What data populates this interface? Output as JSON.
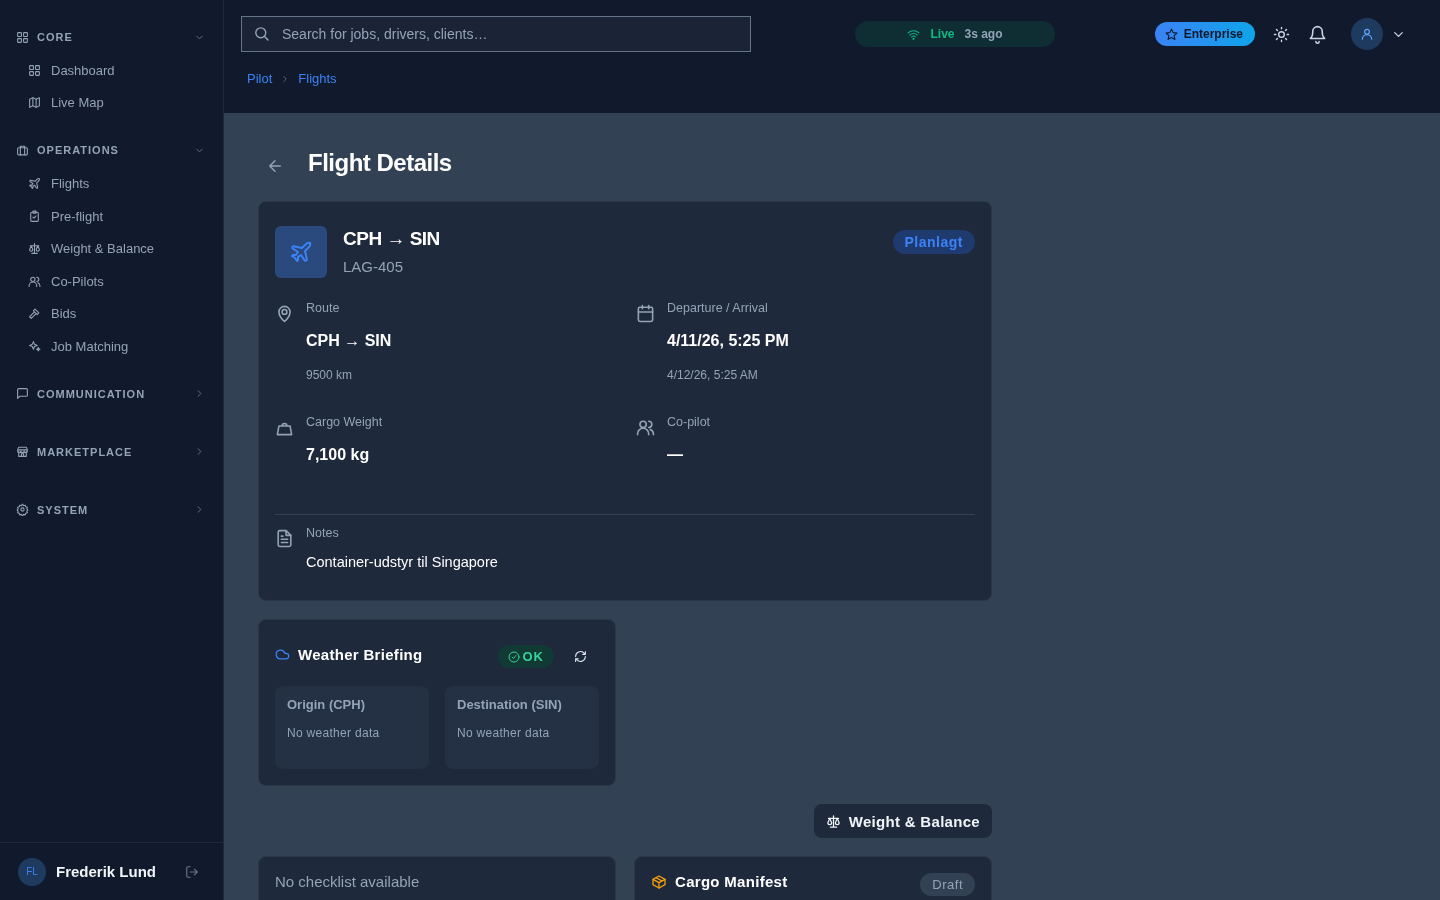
{
  "sidebar": {
    "groups": [
      {
        "label": "CORE",
        "expanded": true,
        "items": [
          "Dashboard",
          "Live Map"
        ]
      },
      {
        "label": "OPERATIONS",
        "expanded": true,
        "items": [
          "Flights",
          "Pre-flight",
          "Weight & Balance",
          "Co-Pilots",
          "Bids",
          "Job Matching"
        ]
      },
      {
        "label": "COMMUNICATION",
        "expanded": false
      },
      {
        "label": "MARKETPLACE",
        "expanded": false
      },
      {
        "label": "SYSTEM",
        "expanded": false
      }
    ],
    "user": {
      "initials": "FL",
      "name": "Frederik Lund"
    }
  },
  "topbar": {
    "search": {
      "placeholder": "Search for jobs, drivers, clients…"
    },
    "live": {
      "label": "Live",
      "age": "3s ago"
    },
    "plan_badge": "Enterprise"
  },
  "breadcrumb": [
    "Pilot",
    "Flights"
  ],
  "page": {
    "title": "Flight Details"
  },
  "flight": {
    "route": "CPH → SIN",
    "code": "LAG-405",
    "status": "Planlagt",
    "fields": [
      {
        "label": "Route",
        "value": "CPH → SIN",
        "sub": "9500 km"
      },
      {
        "label": "Departure / Arrival",
        "value": "4/11/26, 5:25 PM",
        "sub": "4/12/26, 5:25 AM"
      },
      {
        "label": "Cargo Weight",
        "value": "7,100 kg"
      },
      {
        "label": "Co-pilot",
        "value": "—"
      }
    ],
    "notes": {
      "label": "Notes",
      "text": "Container-udstyr til Singapore"
    }
  },
  "weather": {
    "title": "Weather Briefing",
    "status": "OK",
    "stations": [
      {
        "label": "Origin (CPH)",
        "text": "No weather data"
      },
      {
        "label": "Destination (SIN)",
        "text": "No weather data"
      }
    ]
  },
  "weight_balance_button": "Weight & Balance",
  "checklist": {
    "empty": "No checklist available"
  },
  "cargo_manifest": {
    "title": "Cargo Manifest",
    "status": "Draft"
  }
}
